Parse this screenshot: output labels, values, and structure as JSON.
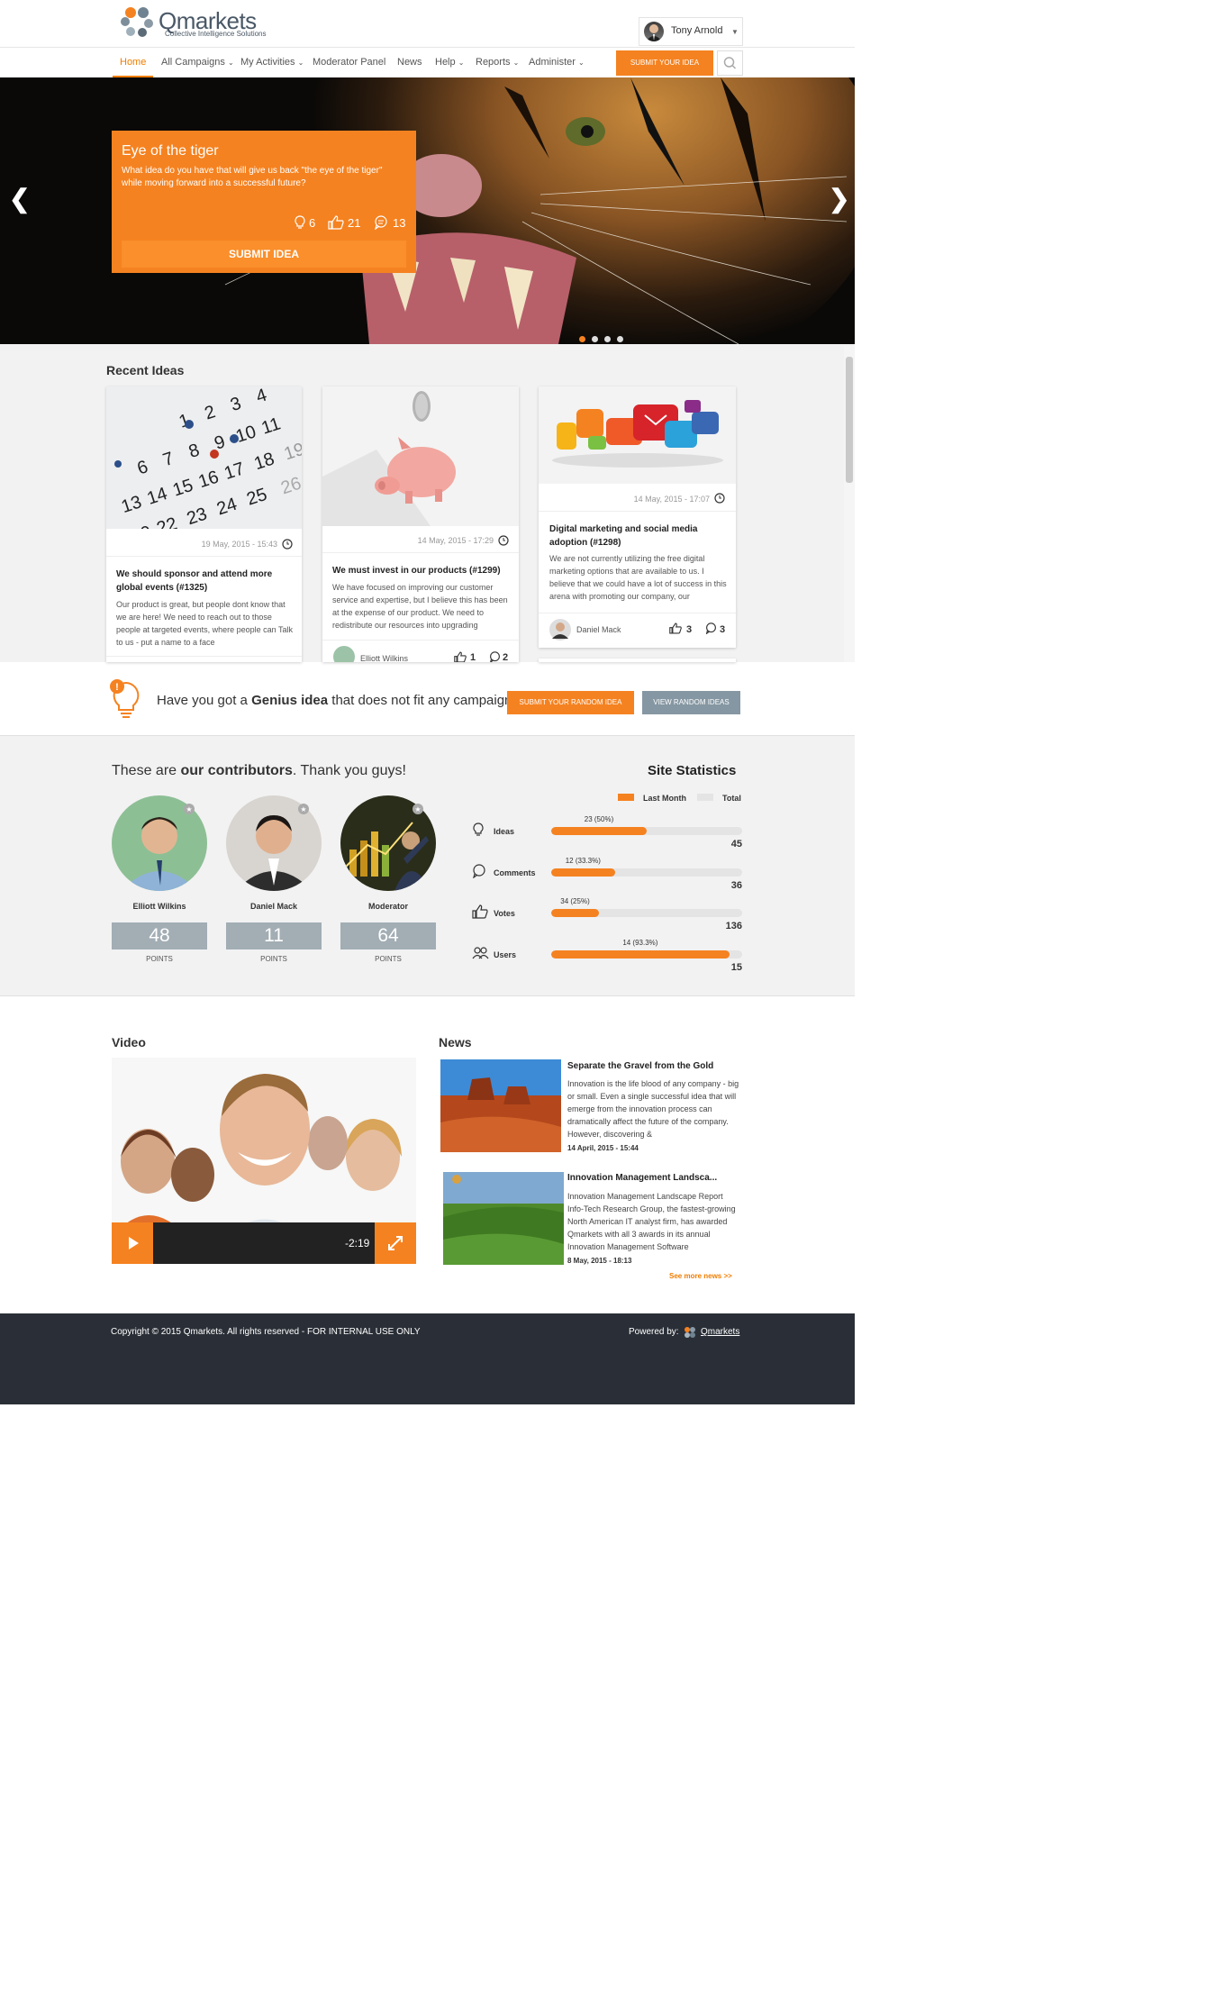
{
  "brand": {
    "name": "Qmarkets",
    "tagline": "Collective Intelligence Solutions",
    "accent": "#f58220"
  },
  "user": {
    "name": "Tony Arnold"
  },
  "nav": {
    "items": [
      {
        "label": "Home",
        "active": true
      },
      {
        "label": "All Campaigns",
        "dropdown": true
      },
      {
        "label": "My Activities",
        "dropdown": true
      },
      {
        "label": "Moderator Panel"
      },
      {
        "label": "News"
      },
      {
        "label": "Help",
        "dropdown": true
      },
      {
        "label": "Reports",
        "dropdown": true
      },
      {
        "label": "Administer",
        "dropdown": true
      }
    ],
    "submit_label": "SUBMIT YOUR IDEA"
  },
  "hero": {
    "title": "Eye of the tiger",
    "description": "What idea do you have that will give us back \"the eye of the tiger\" while moving forward into a successful future?",
    "ideas": "6",
    "votes": "21",
    "comments": "13",
    "button": "SUBMIT IDEA"
  },
  "recent": {
    "title": "Recent Ideas",
    "cards": [
      {
        "date": "19 May, 2015 - 15:43",
        "title": "We should sponsor and attend more global events (#1325)",
        "body": "Our product is great, but people dont know that we are here! We need to reach out to those people at targeted events, where people can Talk to us - put a name to a face"
      },
      {
        "date": "14 May, 2015 - 17:29",
        "title": "We must invest in our products (#1299)",
        "body": "We have focused on improving our customer service and expertise, but I believe this has been at the expense of our product. We need to redistribute our resources into upgrading",
        "author": "Elliott Wilkins",
        "votes": "1",
        "comments": "2"
      },
      {
        "date": "14 May, 2015 - 17:07",
        "title": "Digital marketing and social media adoption (#1298)",
        "body": "We are not currently utilizing the free digital marketing options that are available to us. I believe that we could have a lot of success in this arena with promoting our company, our",
        "author": "Daniel Mack",
        "votes": "3",
        "comments": "3"
      }
    ]
  },
  "genius": {
    "question_pre": "Have you got a ",
    "question_bold": "Genius idea",
    "question_post": " that does not fit any campaign?",
    "submit_random": "SUBMIT YOUR RANDOM IDEA",
    "view_random": "VIEW RANDOM IDEAS"
  },
  "contributors": {
    "title_pre": "These are ",
    "title_bold": "our contributors",
    "title_post": ". Thank you guys!",
    "people": [
      {
        "name": "Elliott Wilkins",
        "points": "48",
        "points_label": "POINTS"
      },
      {
        "name": "Daniel Mack",
        "points": "11",
        "points_label": "POINTS"
      },
      {
        "name": "Moderator",
        "points": "64",
        "points_label": "POINTS"
      }
    ]
  },
  "stats": {
    "title": "Site Statistics",
    "legend": {
      "last_month": "Last Month",
      "total": "Total"
    },
    "rows": [
      {
        "label": "Ideas",
        "value_label": "23 (50%)",
        "fraction": 0.5,
        "total": "45"
      },
      {
        "label": "Comments",
        "value_label": "12 (33.3%)",
        "fraction": 0.333,
        "total": "36"
      },
      {
        "label": "Votes",
        "value_label": "34 (25%)",
        "fraction": 0.25,
        "total": "136"
      },
      {
        "label": "Users",
        "value_label": "14 (93.3%)",
        "fraction": 0.933,
        "total": "15"
      }
    ]
  },
  "video": {
    "title": "Video",
    "time": "-2:19"
  },
  "news": {
    "title": "News",
    "items": [
      {
        "title": "Separate the Gravel from the Gold",
        "body": "Innovation is the life blood of any company - big or small. Even a single successful idea that will emerge from the innovation process can dramatically affect the future of the company. However, discovering &",
        "date": "14 April, 2015 - 15:44"
      },
      {
        "title": "Innovation Management Landsca...",
        "body": "Innovation Management Landscape Report Info-Tech Research Group, the fastest-growing North American IT analyst firm, has awarded Qmarkets with all 3 awards in its annual Innovation Management Software",
        "date": "8 May, 2015 - 18:13"
      }
    ],
    "see_more": "See more news >>"
  },
  "footer": {
    "copyright": "Copyright © 2015 Qmarkets. All rights reserved - FOR INTERNAL USE ONLY",
    "powered": "Powered by:",
    "powered_link": "Qmarkets"
  }
}
